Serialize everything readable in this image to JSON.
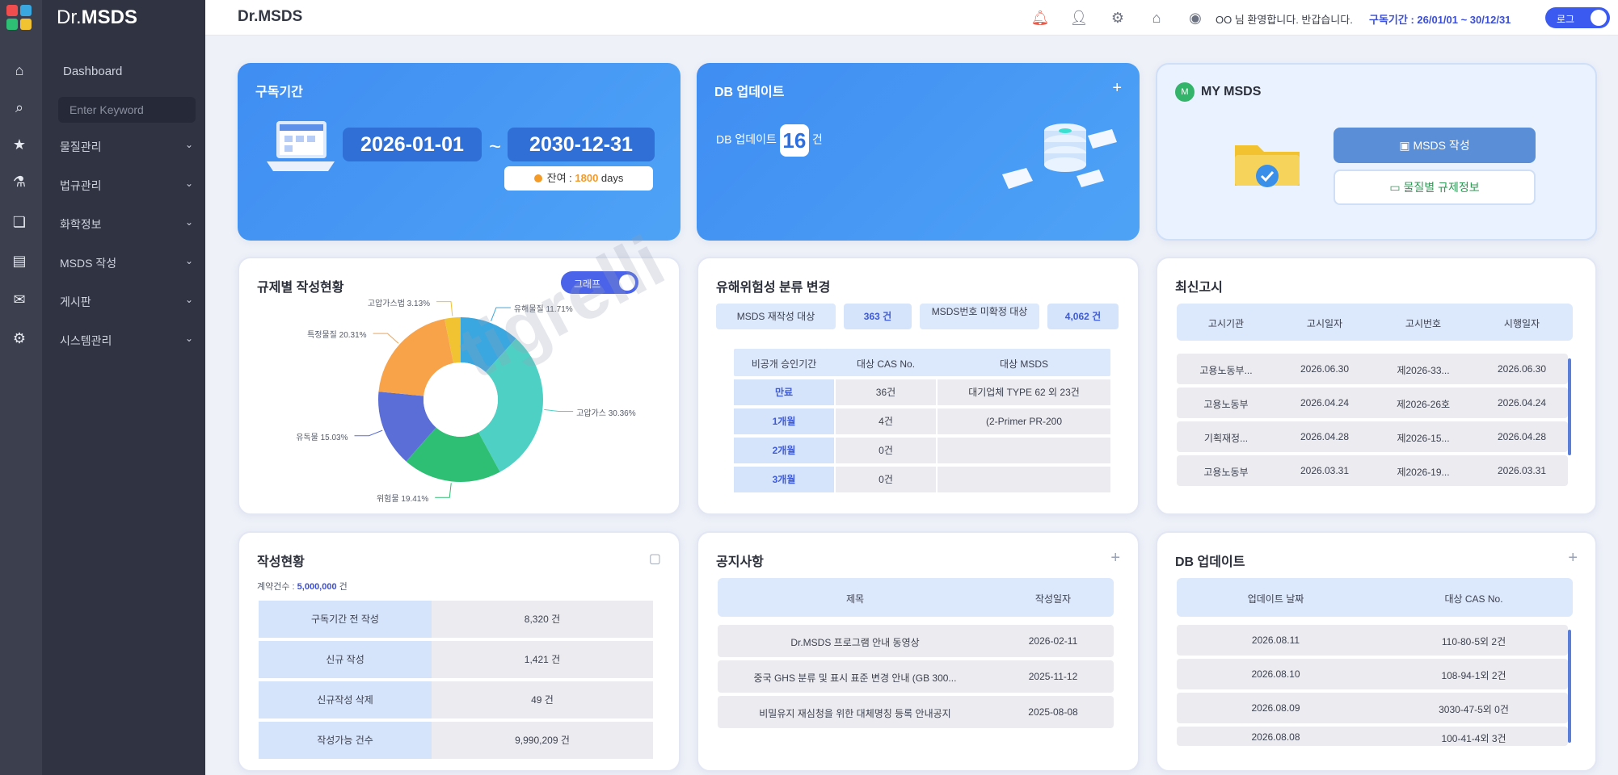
{
  "app": {
    "brand_prefix": "Dr.",
    "brand_name": "MSDS",
    "title": "Dr.MSDS",
    "collapse_icon": "chevron-left"
  },
  "sidebar": {
    "dashboard": "Dashboard",
    "search_placeholder": "Enter Keyword",
    "items": [
      {
        "label": "물질관리",
        "icon": "chevron-down"
      },
      {
        "label": "법규관리",
        "icon": "chevron-down"
      },
      {
        "label": "화학정보",
        "icon": "chevron-down"
      },
      {
        "label": "MSDS 작성",
        "icon": "chevron-down"
      },
      {
        "label": "게시판",
        "icon": "chevron-down"
      },
      {
        "label": "시스템관리",
        "icon": "chevron-down"
      }
    ]
  },
  "topbar": {
    "greeting": "OO 님 환영합니다. 반갑습니다.",
    "period": "구독기간 : 26/01/01 ~ 30/12/31",
    "toggle_label": "로그"
  },
  "subscription": {
    "title": "구독기간",
    "start": "2026-01-01",
    "sep": "~",
    "end": "2030-12-31",
    "remaining_prefix": "잔여 : ",
    "remaining_days": "1800",
    "remaining_suffix": " days"
  },
  "db_update": {
    "title": "DB 업데이트",
    "label": "DB 업데이트",
    "count": "16",
    "unit": "건"
  },
  "my_msds": {
    "badge": "M",
    "title": "MY MSDS",
    "primary_button": "MSDS 작성",
    "secondary_button": "물질별 규제정보"
  },
  "regulation_chart": {
    "title": "규제별 작성현황",
    "toggle_label": "그래프",
    "chart_data": {
      "type": "pie",
      "categories": [
        "유해물질",
        "고압가스",
        "위험물",
        "유독물",
        "특정물",
        "고압가스법"
      ],
      "values": [
        11.71,
        30.36,
        19.41,
        15.03,
        20.31,
        3.13
      ],
      "labels": [
        "유해물질 11.71%",
        "고압가스 30.36%",
        "위험물 19.41%",
        "유독물 15.03%",
        "특정물질 20.31%",
        "고압가스법 3.13%"
      ],
      "colors": [
        "#3aa7e0",
        "#4fd0c5",
        "#2fbf74",
        "#5b6ed8",
        "#f8a34a",
        "#f1c232"
      ]
    }
  },
  "hazard_change": {
    "title": "유해위험성 분류 변경",
    "summary": [
      {
        "label": "MSDS 재작성 대상",
        "value": "363 건"
      },
      {
        "label": "MSDS번호 미확정 대상",
        "value": "4,062 건"
      }
    ],
    "headers": [
      "비공개 승인기간",
      "대상 CAS No.",
      "대상 MSDS"
    ],
    "rows": [
      [
        "만료",
        "36건",
        "대기업체 TYPE 62 외 23건"
      ],
      [
        "1개월",
        "4건",
        "(2-Primer PR-200"
      ],
      [
        "2개월",
        "0건",
        ""
      ],
      [
        "3개월",
        "0건",
        ""
      ]
    ]
  },
  "notice_board": {
    "title": "최신고시",
    "headers": [
      "고시기관",
      "고시일자",
      "고시번호",
      "시행일자"
    ],
    "rows": [
      [
        "고용노동부...",
        "2026.06.30",
        "제2026-33...",
        "2026.06.30"
      ],
      [
        "고용노동부",
        "2026.04.24",
        "제2026-26호",
        "2026.04.24"
      ],
      [
        "기획재정...",
        "2026.04.28",
        "제2026-15...",
        "2026.04.28"
      ],
      [
        "고용노동부",
        "2026.03.31",
        "제2026-19...",
        "2026.03.31"
      ]
    ]
  },
  "writing_status": {
    "title": "작성현황",
    "subtitle_prefix": "계약건수 : ",
    "subtitle_value": "5,000,000",
    "subtitle_suffix": " 건",
    "rows": [
      [
        "구독기간 전 작성",
        "8,320 건"
      ],
      [
        "신규 작성",
        "1,421 건"
      ],
      [
        "신규작성 삭제",
        "49 건"
      ],
      [
        "작성가능 건수",
        "9,990,209 건"
      ]
    ]
  },
  "announcements": {
    "title": "공지사항",
    "headers": [
      "제목",
      "작성일자"
    ],
    "rows": [
      [
        "Dr.MSDS 프로그램 안내 동영상",
        "2026-02-11"
      ],
      [
        "중국 GHS 분류 및 표시 표준 변경 안내 (GB 300...",
        "2025-11-12"
      ],
      [
        "비밀유지 재심청을 위한 대체명칭 등록 안내공지",
        "2025-08-08"
      ]
    ]
  },
  "db_update_list": {
    "title": "DB 업데이트",
    "headers": [
      "업데이트 날짜",
      "대상 CAS No."
    ],
    "rows": [
      [
        "2026.08.11",
        "110-80-5외 2건"
      ],
      [
        "2026.08.10",
        "108-94-1외 2건"
      ],
      [
        "2026.08.09",
        "3030-47-5외 0건"
      ],
      [
        "2026.08.08",
        "100-41-4외 3건"
      ]
    ]
  },
  "watermark": "tigrelli"
}
